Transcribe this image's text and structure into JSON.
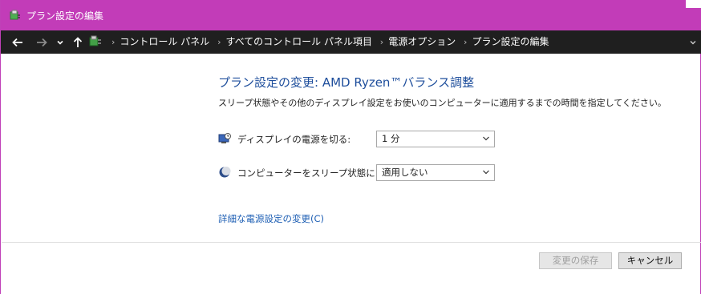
{
  "window": {
    "title": "プラン設定の編集",
    "titlebar_color": "#c23cb8"
  },
  "nav": {
    "back_icon": "arrow-left-icon",
    "forward_icon": "arrow-right-icon",
    "recent_icon": "chevron-down-icon",
    "up_icon": "arrow-up-icon",
    "breadcrumbs": [
      "コントロール パネル",
      "すべてのコントロール パネル項目",
      "電源オプション",
      "プラン設定の編集"
    ]
  },
  "main": {
    "heading": "プラン設定の変更: AMD Ryzen™バランス調整",
    "description": "スリープ状態やその他のディスプレイ設定をお使いのコンピューターに適用するまでの時間を指定してください。",
    "settings": [
      {
        "label": "ディスプレイの電源を切る:",
        "value": "1 分",
        "icon": "display-icon"
      },
      {
        "label": "コンピューターをスリープ状態にする:",
        "value": "適用しない",
        "icon": "moon-icon"
      }
    ],
    "advanced_link": "詳細な電源設定の変更(C)"
  },
  "footer": {
    "save_label": "変更の保存",
    "cancel_label": "キャンセル"
  }
}
